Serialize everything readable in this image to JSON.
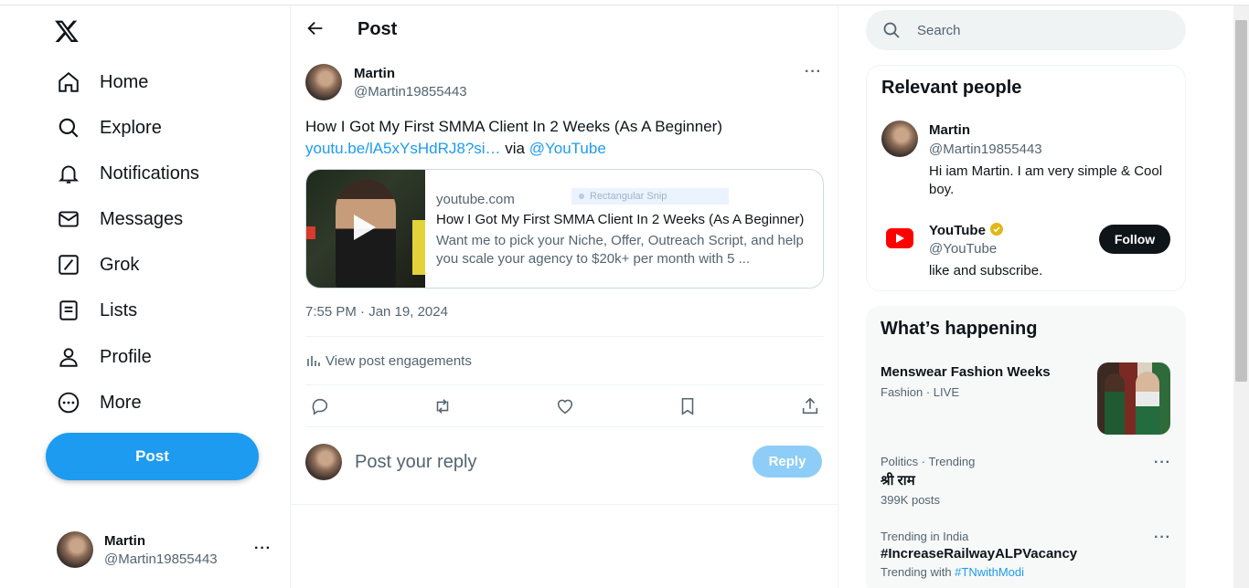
{
  "nav": {
    "items": [
      {
        "label": "Home",
        "icon": "home-icon"
      },
      {
        "label": "Explore",
        "icon": "search-icon"
      },
      {
        "label": "Notifications",
        "icon": "bell-icon"
      },
      {
        "label": "Messages",
        "icon": "envelope-icon"
      },
      {
        "label": "Grok",
        "icon": "grok-icon"
      },
      {
        "label": "Lists",
        "icon": "list-icon"
      },
      {
        "label": "Profile",
        "icon": "person-icon"
      },
      {
        "label": "More",
        "icon": "more-circle-icon"
      }
    ],
    "post_button": "Post",
    "account": {
      "name": "Martin",
      "handle": "@Martin19855443",
      "more": "···"
    }
  },
  "main": {
    "header_title": "Post",
    "post": {
      "author_name": "Martin",
      "author_handle": "@Martin19855443",
      "more": "···",
      "text_line1": "How I Got My First SMMA Client In 2 Weeks (As A Beginner)",
      "link_text": "youtu.be/lA5xYsHdRJ8?si…",
      "via_text": " via ",
      "mention": "@YouTube",
      "card": {
        "domain": "youtube.com",
        "title": "How I Got My First SMMA Client In 2 Weeks (As A Beginner)",
        "description": "Want me to pick your Niche, Offer, Outreach Script, and help you scale your agency to $20k+ per month with 5 ..."
      },
      "snip_overlay": "Rectangular Snip",
      "timestamp": "7:55 PM · Jan 19, 2024",
      "engagements_label": "View post engagements"
    },
    "reply": {
      "placeholder": "Post your reply",
      "button": "Reply"
    }
  },
  "right": {
    "search_placeholder": "Search",
    "relevant": {
      "title": "Relevant people",
      "people": [
        {
          "name": "Martin",
          "handle": "@Martin19855443",
          "bio": "Hi iam Martin. I am very simple & Cool boy."
        },
        {
          "name": "YouTube",
          "handle": "@YouTube",
          "bio": "like and subscribe.",
          "follow": "Follow"
        }
      ]
    },
    "happening": {
      "title": "What’s happening",
      "trends": [
        {
          "meta": "Fashion · LIVE",
          "name": "Menswear Fashion Weeks"
        },
        {
          "meta": "Politics · Trending",
          "name": "श्री राम",
          "sub": "399K posts"
        },
        {
          "meta": "Trending in India",
          "name": "#IncreaseRailwayALPVacancy",
          "sub_prefix": "Trending with ",
          "sub_link": "#TNwithModi"
        }
      ]
    }
  },
  "colors": {
    "accent": "#1d9bf0",
    "text": "#0f1419",
    "muted": "#536471",
    "youtube_red": "#ff0000"
  }
}
